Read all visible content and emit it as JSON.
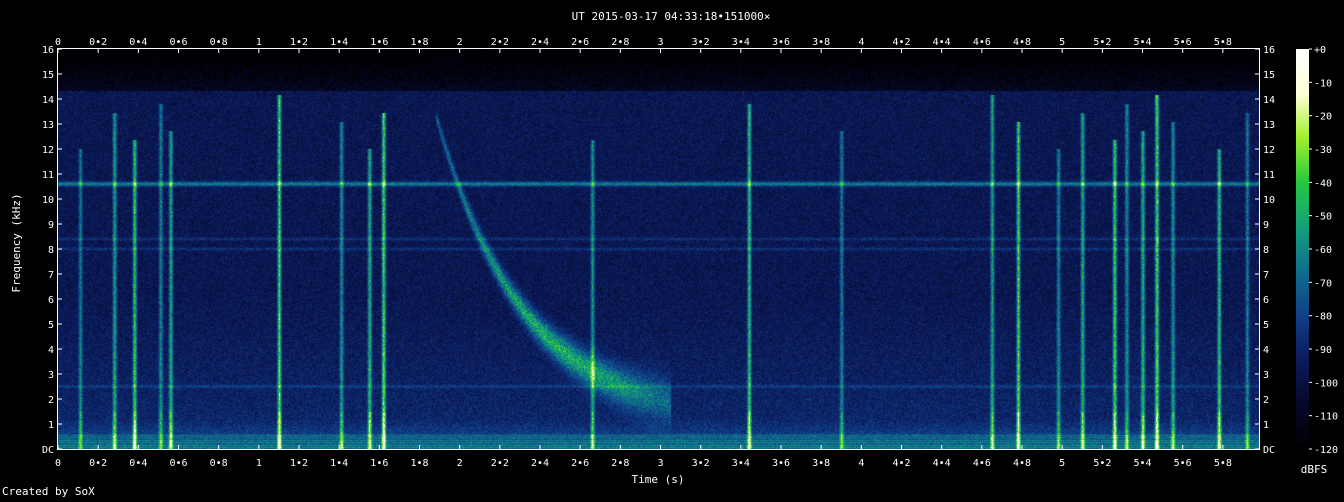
{
  "chart_data": {
    "type": "heatmap",
    "title": "UT 2015-03-17 04:33:18•151000×",
    "xlabel": "Time (s)",
    "ylabel": "Frequency (kHz)",
    "xlim": [
      0,
      5.98
    ],
    "ylim": [
      0,
      16
    ],
    "x_ticks": [
      "0",
      "0•2",
      "0•4",
      "0•6",
      "0•8",
      "1",
      "1•2",
      "1•4",
      "1•6",
      "1•8",
      "2",
      "2•2",
      "2•4",
      "2•6",
      "2•8",
      "3",
      "3•2",
      "3•4",
      "3•6",
      "3•8",
      "4",
      "4•2",
      "4•4",
      "4•6",
      "4•8",
      "5",
      "5•2",
      "5•4",
      "5•6",
      "5•8"
    ],
    "x_tick_values": [
      0,
      0.2,
      0.4,
      0.6,
      0.8,
      1,
      1.2,
      1.4,
      1.6,
      1.8,
      2,
      2.2,
      2.4,
      2.6,
      2.8,
      3,
      3.2,
      3.4,
      3.6,
      3.8,
      4,
      4.2,
      4.4,
      4.6,
      4.8,
      5,
      5.2,
      5.4,
      5.6,
      5.8
    ],
    "y_ticks": [
      "DC",
      "1",
      "2",
      "3",
      "4",
      "5",
      "6",
      "7",
      "8",
      "9",
      "10",
      "11",
      "12",
      "13",
      "14",
      "15",
      "16"
    ],
    "y_tick_values": [
      0,
      1,
      2,
      3,
      4,
      5,
      6,
      7,
      8,
      9,
      10,
      11,
      12,
      13,
      14,
      15,
      16
    ],
    "colorbar": {
      "label": "dBFS",
      "ticks": [
        "+0",
        "-10",
        "-20",
        "-30",
        "-40",
        "-50",
        "-60",
        "-70",
        "-80",
        "-90",
        "-100",
        "-110",
        "-120"
      ],
      "tick_values": [
        0,
        -10,
        -20,
        -30,
        -40,
        -50,
        -60,
        -70,
        -80,
        -90,
        -100,
        -110,
        -120
      ],
      "range": [
        -120,
        0
      ]
    },
    "features": {
      "hum_line_khz": 10.6,
      "secondary_lines_khz": [
        8.4,
        8.0,
        2.5
      ],
      "whistler": {
        "t_start": 1.88,
        "f_start": 13.4,
        "t_end": 3.0,
        "f_end": 2.0,
        "tau": 0.43
      },
      "sferics_s": [
        0.11,
        0.28,
        0.38,
        0.51,
        0.56,
        1.1,
        1.41,
        1.55,
        1.62,
        2.66,
        3.44,
        3.9,
        4.65,
        4.78,
        4.98,
        5.1,
        5.26,
        5.32,
        5.4,
        5.47,
        5.55,
        5.78,
        5.92
      ],
      "colors": [
        "#000000",
        "#06082a",
        "#0b1a5a",
        "#103f88",
        "#0f6e8c",
        "#14a07a",
        "#25c840",
        "#9ff02a",
        "#ffffd8",
        "#ffffff"
      ]
    }
  },
  "footer": {
    "credit": "Created by SoX"
  }
}
